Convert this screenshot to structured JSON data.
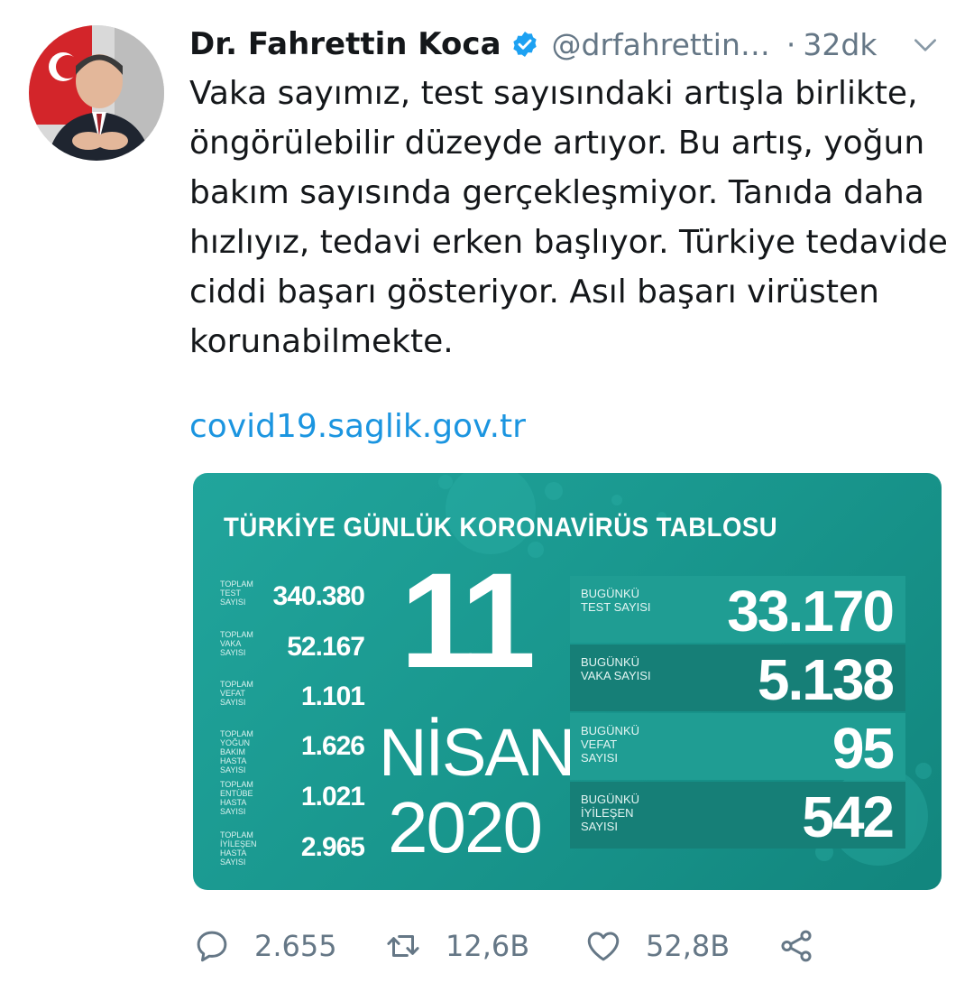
{
  "tweet": {
    "author_name": "Dr. Fahrettin Koca",
    "handle": "@drfahrettin…",
    "dot": "·",
    "time": "32dk",
    "text": "Vaka sayımız, test sayısındaki artışla birlikte, öngörülebilir düzeyde artıyor. Bu artış, yoğun bakım sayısında gerçekleşmiyor. Tanıda daha hızlıyız, tedavi erken başlıyor. Türkiye tedavide ciddi başarı gösteriyor. Asıl başarı virüsten korunabilmekte.",
    "link": "covid19.saglik.gov.tr"
  },
  "media": {
    "title": "TÜRKİYE GÜNLÜK KORONAVİRÜS TABLOSU",
    "date": {
      "day": "11",
      "month": "NİSAN",
      "year": "2020"
    },
    "totals": [
      {
        "label": "TOPLAM TEST SAYISI",
        "value": "340.380"
      },
      {
        "label": "TOPLAM VAKA SAYISI",
        "value": "52.167"
      },
      {
        "label": "TOPLAM VEFAT SAYISI",
        "value": "1.101"
      },
      {
        "label": "TOPLAM YOĞUN BAKIM HASTA SAYISI",
        "value": "1.626"
      },
      {
        "label": "TOPLAM ENTÜBE HASTA SAYISI",
        "value": "1.021"
      },
      {
        "label": "TOPLAM İYİLEŞEN HASTA SAYISI",
        "value": "2.965"
      }
    ],
    "daily": [
      {
        "label": "BUGÜNKÜ TEST SAYISI",
        "value": "33.170"
      },
      {
        "label": "BUGÜNKÜ VAKA SAYISI",
        "value": "5.138"
      },
      {
        "label": "BUGÜNKÜ VEFAT SAYISI",
        "value": "95"
      },
      {
        "label": "BUGÜNKÜ İYİLEŞEN SAYISI",
        "value": "542"
      }
    ]
  },
  "actions": {
    "replies": "2.655",
    "retweets": "12,6B",
    "likes": "52,8B"
  },
  "icons": {
    "verified": "verified-badge-icon",
    "caret": "chevron-down-icon",
    "reply": "reply-icon",
    "retweet": "retweet-icon",
    "like": "heart-icon",
    "share": "share-icon"
  },
  "colors": {
    "link": "#1b95e0",
    "secondary_text": "#657786",
    "verified": "#1da1f2",
    "card_teal": "#18958c"
  }
}
